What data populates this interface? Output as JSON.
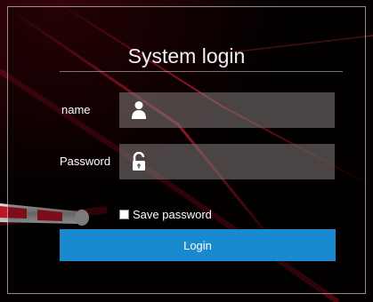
{
  "form": {
    "title": "System login",
    "name_label": "name",
    "password_label": "Password",
    "name_value": "",
    "password_value": "",
    "save_password_label": "Save password",
    "save_password_checked": false,
    "login_label": "Login"
  },
  "icons": {
    "name_field": "user-icon",
    "password_field": "lock-icon"
  },
  "colors": {
    "accent": "#1a8ad0",
    "background": "#050000",
    "field_bg": "#6e6464",
    "light_streak": "#c0142a"
  }
}
